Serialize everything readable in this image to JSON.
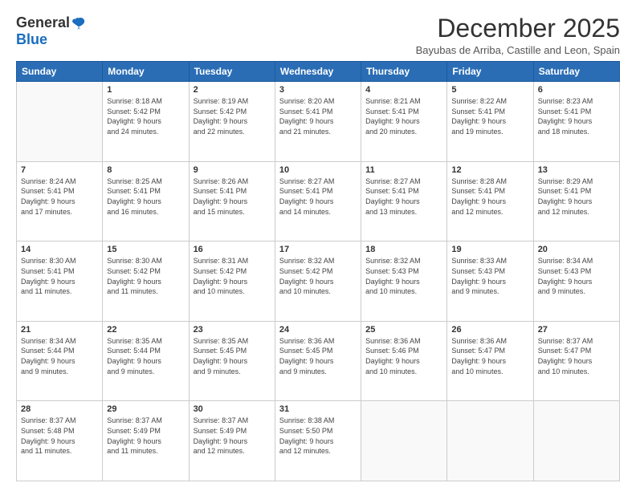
{
  "logo": {
    "general": "General",
    "blue": "Blue"
  },
  "title": "December 2025",
  "subtitle": "Bayubas de Arriba, Castille and Leon, Spain",
  "header_days": [
    "Sunday",
    "Monday",
    "Tuesday",
    "Wednesday",
    "Thursday",
    "Friday",
    "Saturday"
  ],
  "weeks": [
    [
      {
        "day": "",
        "info": ""
      },
      {
        "day": "1",
        "info": "Sunrise: 8:18 AM\nSunset: 5:42 PM\nDaylight: 9 hours\nand 24 minutes."
      },
      {
        "day": "2",
        "info": "Sunrise: 8:19 AM\nSunset: 5:42 PM\nDaylight: 9 hours\nand 22 minutes."
      },
      {
        "day": "3",
        "info": "Sunrise: 8:20 AM\nSunset: 5:41 PM\nDaylight: 9 hours\nand 21 minutes."
      },
      {
        "day": "4",
        "info": "Sunrise: 8:21 AM\nSunset: 5:41 PM\nDaylight: 9 hours\nand 20 minutes."
      },
      {
        "day": "5",
        "info": "Sunrise: 8:22 AM\nSunset: 5:41 PM\nDaylight: 9 hours\nand 19 minutes."
      },
      {
        "day": "6",
        "info": "Sunrise: 8:23 AM\nSunset: 5:41 PM\nDaylight: 9 hours\nand 18 minutes."
      }
    ],
    [
      {
        "day": "7",
        "info": "Sunrise: 8:24 AM\nSunset: 5:41 PM\nDaylight: 9 hours\nand 17 minutes."
      },
      {
        "day": "8",
        "info": "Sunrise: 8:25 AM\nSunset: 5:41 PM\nDaylight: 9 hours\nand 16 minutes."
      },
      {
        "day": "9",
        "info": "Sunrise: 8:26 AM\nSunset: 5:41 PM\nDaylight: 9 hours\nand 15 minutes."
      },
      {
        "day": "10",
        "info": "Sunrise: 8:27 AM\nSunset: 5:41 PM\nDaylight: 9 hours\nand 14 minutes."
      },
      {
        "day": "11",
        "info": "Sunrise: 8:27 AM\nSunset: 5:41 PM\nDaylight: 9 hours\nand 13 minutes."
      },
      {
        "day": "12",
        "info": "Sunrise: 8:28 AM\nSunset: 5:41 PM\nDaylight: 9 hours\nand 12 minutes."
      },
      {
        "day": "13",
        "info": "Sunrise: 8:29 AM\nSunset: 5:41 PM\nDaylight: 9 hours\nand 12 minutes."
      }
    ],
    [
      {
        "day": "14",
        "info": "Sunrise: 8:30 AM\nSunset: 5:41 PM\nDaylight: 9 hours\nand 11 minutes."
      },
      {
        "day": "15",
        "info": "Sunrise: 8:30 AM\nSunset: 5:42 PM\nDaylight: 9 hours\nand 11 minutes."
      },
      {
        "day": "16",
        "info": "Sunrise: 8:31 AM\nSunset: 5:42 PM\nDaylight: 9 hours\nand 10 minutes."
      },
      {
        "day": "17",
        "info": "Sunrise: 8:32 AM\nSunset: 5:42 PM\nDaylight: 9 hours\nand 10 minutes."
      },
      {
        "day": "18",
        "info": "Sunrise: 8:32 AM\nSunset: 5:43 PM\nDaylight: 9 hours\nand 10 minutes."
      },
      {
        "day": "19",
        "info": "Sunrise: 8:33 AM\nSunset: 5:43 PM\nDaylight: 9 hours\nand 9 minutes."
      },
      {
        "day": "20",
        "info": "Sunrise: 8:34 AM\nSunset: 5:43 PM\nDaylight: 9 hours\nand 9 minutes."
      }
    ],
    [
      {
        "day": "21",
        "info": "Sunrise: 8:34 AM\nSunset: 5:44 PM\nDaylight: 9 hours\nand 9 minutes."
      },
      {
        "day": "22",
        "info": "Sunrise: 8:35 AM\nSunset: 5:44 PM\nDaylight: 9 hours\nand 9 minutes."
      },
      {
        "day": "23",
        "info": "Sunrise: 8:35 AM\nSunset: 5:45 PM\nDaylight: 9 hours\nand 9 minutes."
      },
      {
        "day": "24",
        "info": "Sunrise: 8:36 AM\nSunset: 5:45 PM\nDaylight: 9 hours\nand 9 minutes."
      },
      {
        "day": "25",
        "info": "Sunrise: 8:36 AM\nSunset: 5:46 PM\nDaylight: 9 hours\nand 10 minutes."
      },
      {
        "day": "26",
        "info": "Sunrise: 8:36 AM\nSunset: 5:47 PM\nDaylight: 9 hours\nand 10 minutes."
      },
      {
        "day": "27",
        "info": "Sunrise: 8:37 AM\nSunset: 5:47 PM\nDaylight: 9 hours\nand 10 minutes."
      }
    ],
    [
      {
        "day": "28",
        "info": "Sunrise: 8:37 AM\nSunset: 5:48 PM\nDaylight: 9 hours\nand 11 minutes."
      },
      {
        "day": "29",
        "info": "Sunrise: 8:37 AM\nSunset: 5:49 PM\nDaylight: 9 hours\nand 11 minutes."
      },
      {
        "day": "30",
        "info": "Sunrise: 8:37 AM\nSunset: 5:49 PM\nDaylight: 9 hours\nand 12 minutes."
      },
      {
        "day": "31",
        "info": "Sunrise: 8:38 AM\nSunset: 5:50 PM\nDaylight: 9 hours\nand 12 minutes."
      },
      {
        "day": "",
        "info": ""
      },
      {
        "day": "",
        "info": ""
      },
      {
        "day": "",
        "info": ""
      }
    ]
  ]
}
